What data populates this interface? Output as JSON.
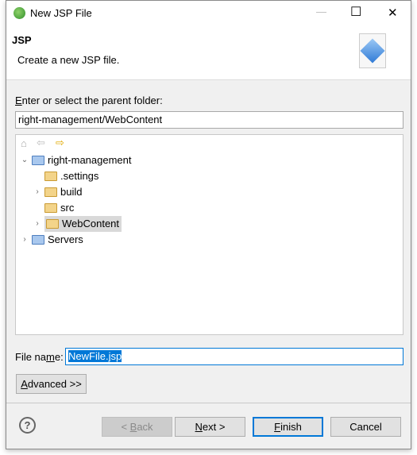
{
  "window": {
    "title": "New JSP File",
    "minimize": "—",
    "maximize": "☐",
    "close": "✕"
  },
  "header": {
    "title": "JSP",
    "description": "Create a new JSP file."
  },
  "folder": {
    "label_pre": "",
    "label_u": "E",
    "label_post": "nter or select the parent folder:",
    "value": "right-management/WebContent"
  },
  "tree": {
    "items": [
      {
        "label": "right-management",
        "expanded": true
      },
      {
        "label": ".settings"
      },
      {
        "label": "build",
        "expandable": true
      },
      {
        "label": "src"
      },
      {
        "label": "WebContent",
        "expandable": true,
        "selected": true
      },
      {
        "label": "Servers",
        "expandable": true
      }
    ]
  },
  "filename": {
    "label_pre": "File na",
    "label_u": "m",
    "label_post": "e:",
    "value": "NewFile.jsp"
  },
  "buttons": {
    "advanced_u": "A",
    "advanced_rest": "dvanced >>",
    "back_pre": "< ",
    "back_u": "B",
    "back_rest": "ack",
    "next_u": "N",
    "next_rest": "ext >",
    "finish_u": "F",
    "finish_rest": "inish",
    "cancel": "Cancel"
  },
  "colors": {
    "accent": "#0078d7",
    "selection": "#0078d7"
  }
}
